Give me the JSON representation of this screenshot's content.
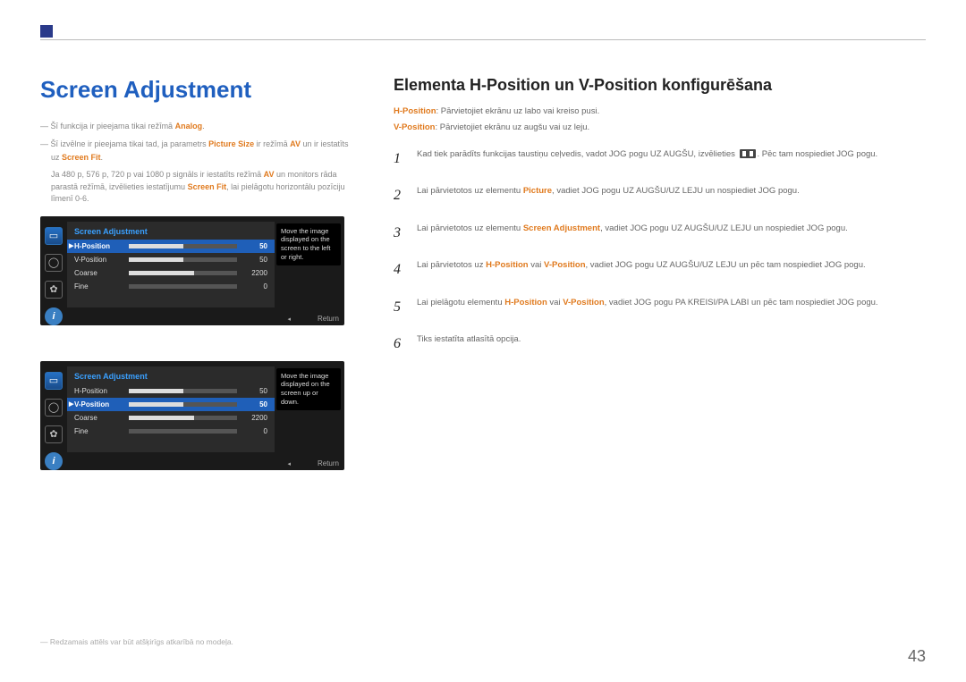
{
  "section_title": "Screen Adjustment",
  "right_title": "Elementa H-Position un V-Position konfigurēšana",
  "notes": {
    "n1_pre": "Šī funkcija ir pieejama tikai režīmā ",
    "n1_kw": "Analog",
    "n1_post": ".",
    "n2_pre": "Šī izvēlne ir pieejama tikai tad, ja parametrs ",
    "n2_kw1": "Picture Size",
    "n2_mid": " ir režīmā ",
    "n2_kw2": "AV",
    "n2_post1": " un ir iestatīts uz ",
    "n2_kw3": "Screen Fit",
    "n2_post2": ".",
    "sub_pre": "Ja 480 p, 576 p, 720 p vai 1080 p signāls ir iestatīts režīmā ",
    "sub_kw1": "AV",
    "sub_mid": " un monitors rāda parastā režīmā, izvēlieties iestatījumu ",
    "sub_kw2": "Screen Fit",
    "sub_post": ", lai pielāgotu horizontālu pozīciju līmenī 0-6."
  },
  "osd": {
    "header": "Screen Adjustment",
    "rows": [
      {
        "label": "H-Position",
        "value": "50",
        "fill": 50
      },
      {
        "label": "V-Position",
        "value": "50",
        "fill": 50
      },
      {
        "label": "Coarse",
        "value": "2200",
        "fill": 60
      },
      {
        "label": "Fine",
        "value": "0",
        "fill": 0
      }
    ],
    "tooltip1": "Move the image displayed on the screen to the left or right.",
    "tooltip2": "Move the image displayed on the screen up or down.",
    "return": "Return"
  },
  "descs": {
    "d1_kw": "H-Position",
    "d1": ": Pārvietojiet ekrānu uz labo vai kreiso pusi.",
    "d2_kw": "V-Position",
    "d2": ": Pārvietojiet ekrānu uz augšu vai uz leju."
  },
  "steps": {
    "s1a": "Kad tiek parādīts funkcijas taustiņu ceļvedis, vadot JOG pogu UZ AUGŠU, izvēlieties ",
    "s1b": ". Pēc tam nospiediet JOG pogu.",
    "s2a": "Lai pārvietotos uz elementu ",
    "s2kw": "Picture",
    "s2b": ", vadiet JOG pogu UZ AUGŠU/UZ LEJU un nospiediet JOG pogu.",
    "s3a": "Lai pārvietotos uz elementu ",
    "s3kw": "Screen Adjustment",
    "s3b": ", vadiet JOG pogu UZ AUGŠU/UZ LEJU un nospiediet JOG pogu.",
    "s4a": "Lai pārvietotos uz ",
    "s4kw1": "H-Position",
    "s4mid": " vai ",
    "s4kw2": "V-Position",
    "s4b": ", vadiet JOG pogu UZ AUGŠU/UZ LEJU un pēc tam nospiediet JOG pogu.",
    "s5a": "Lai pielāgotu elementu ",
    "s5kw1": "H-Position",
    "s5mid": " vai ",
    "s5kw2": "V-Position",
    "s5b": ", vadiet JOG pogu PA KREISI/PA LABI un pēc tam nospiediet JOG pogu.",
    "s6": "Tiks iestatīta atlasītā opcija."
  },
  "disclaimer": "Redzamais attēls var būt atšķirīgs atkarībā no modeļa.",
  "page_number": "43"
}
